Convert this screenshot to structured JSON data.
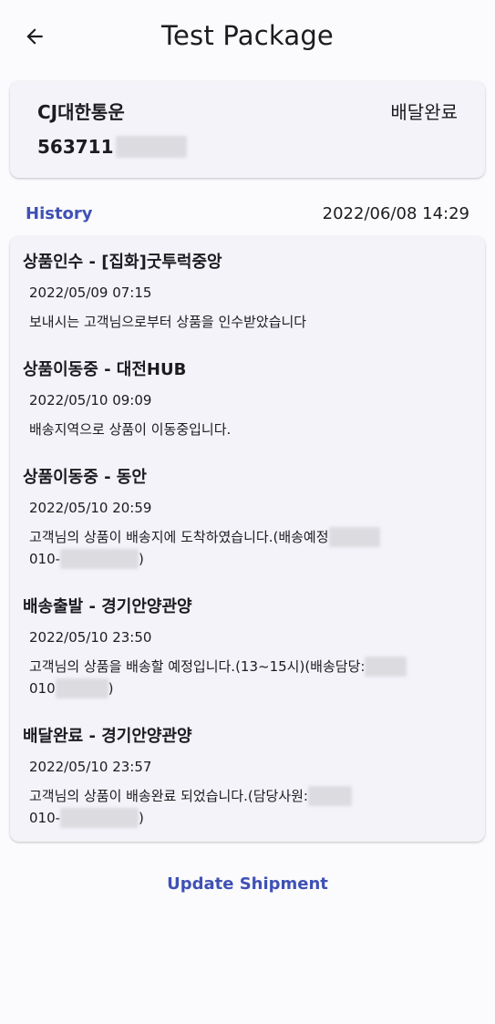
{
  "header": {
    "title": "Test Package"
  },
  "carrier": {
    "name": "CJ대한통운",
    "status": "배달완료",
    "tracking_prefix": "563711"
  },
  "history": {
    "label": "History",
    "last_updated": "2022/06/08 14:29",
    "events": [
      {
        "title": "상품인수 - [집화]굿투럭중앙",
        "time": "2022/05/09 07:15",
        "desc": "보내시는 고객님으로부터 상품을 인수받았습니다"
      },
      {
        "title": "상품이동중 - 대전HUB",
        "time": "2022/05/10 09:09",
        "desc": "배송지역으로 상품이 이동중입니다."
      },
      {
        "title": "상품이동중 - 동안",
        "time": "2022/05/10 20:59",
        "desc": "고객님의 상품이 배송지에 도착하였습니다.(배송예정",
        "desc2_prefix": "010-",
        "desc2_suffix": ")"
      },
      {
        "title": "배송출발 - 경기안양관양",
        "time": "2022/05/10 23:50",
        "desc": "고객님의 상품을 배송할 예정입니다.(13~15시)(배송담당:",
        "desc2_prefix": "010",
        "desc2_suffix": ")"
      },
      {
        "title": "배달완료 - 경기안양관양",
        "time": "2022/05/10 23:57",
        "desc": "고객님의 상품이 배송완료 되었습니다.(담당사원:",
        "desc2_prefix": "010-",
        "desc2_suffix": ")"
      }
    ]
  },
  "actions": {
    "update_label": "Update Shipment"
  },
  "colors": {
    "accent": "#3f51b5",
    "card_bg": "#f3f3f9",
    "page_bg": "#fbfbfd"
  },
  "icons": {
    "back": "arrow-left-icon"
  }
}
